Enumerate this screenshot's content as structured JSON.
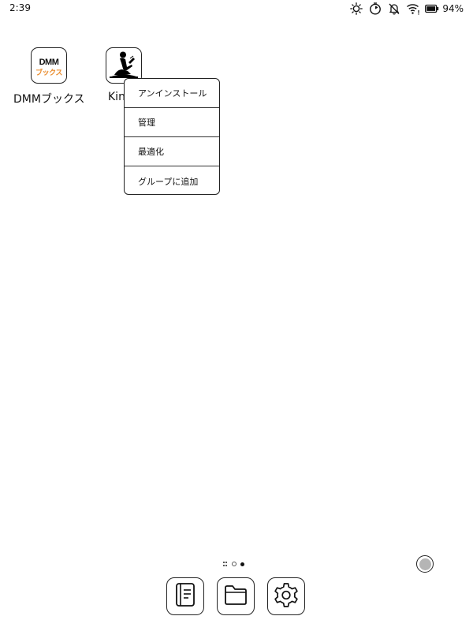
{
  "status_bar": {
    "time": "2:39",
    "battery_percent": "94%",
    "icons": [
      "brightness-icon",
      "timer-icon",
      "bell-off-icon",
      "wifi-icon",
      "battery-icon"
    ]
  },
  "apps": [
    {
      "label": "DMMブックス",
      "logo_top": "DMM",
      "logo_bottom": "ブックス",
      "icon": "dmm-books-icon",
      "brand_color": "#e98a2a"
    },
    {
      "label": "Kin",
      "icon": "kindle-icon"
    }
  ],
  "context_menu": {
    "items": [
      {
        "label": "アンインストール"
      },
      {
        "label": "管理"
      },
      {
        "label": "最適化"
      },
      {
        "label": "グループに追加"
      }
    ]
  },
  "page_indicator": {
    "icons": [
      "apps-grid-icon",
      "page-dot-empty",
      "page-dot-filled"
    ]
  },
  "float_ball": {
    "icon": "floating-ball-icon"
  },
  "dock": {
    "items": [
      {
        "icon": "notebook-icon"
      },
      {
        "icon": "folder-icon"
      },
      {
        "icon": "gear-icon"
      }
    ]
  }
}
